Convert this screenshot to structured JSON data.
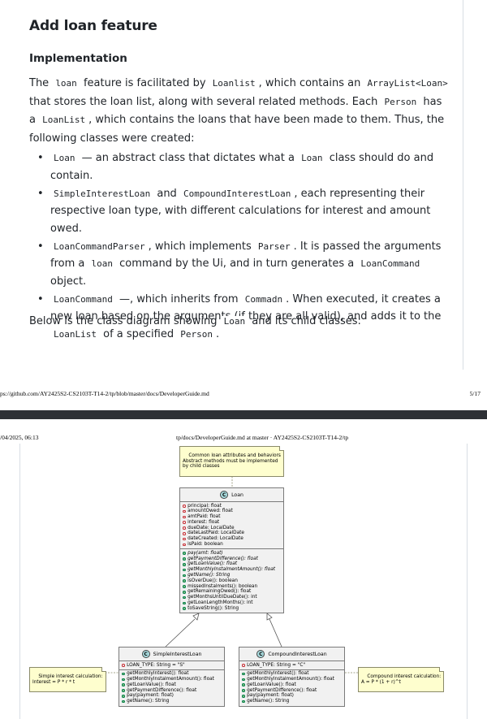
{
  "page1": {
    "heading": "Add loan feature",
    "subheading": "Implementation",
    "paragraph1": [
      {
        "t": "The "
      },
      {
        "c": "loan"
      },
      {
        "t": " feature is facilitated by "
      },
      {
        "c": "Loanlist"
      },
      {
        "t": ", which contains an "
      },
      {
        "c": "ArrayList<Loan>"
      },
      {
        "t": " that stores the loan list, along with several related methods. Each "
      },
      {
        "c": "Person"
      },
      {
        "t": " has a "
      },
      {
        "c": "LoanList"
      },
      {
        "t": ", which contains the loans that have been made to them. Thus, the following classes were created:"
      }
    ],
    "bullets": [
      [
        {
          "c": "Loan"
        },
        {
          "t": " — an abstract class that dictates what a "
        },
        {
          "c": "Loan"
        },
        {
          "t": " class should do and contain."
        }
      ],
      [
        {
          "c": "SimpleInterestLoan"
        },
        {
          "t": " and "
        },
        {
          "c": "CompoundInterestLoan"
        },
        {
          "t": ", each representing their respective loan type, with different calculations for interest and amount owed."
        }
      ],
      [
        {
          "c": "LoanCommandParser"
        },
        {
          "t": ", which implements "
        },
        {
          "c": "Parser"
        },
        {
          "t": ". It is passed the arguments from a "
        },
        {
          "c": "loan"
        },
        {
          "t": " command by the Ui, and in turn generates a "
        },
        {
          "c": "LoanCommand"
        },
        {
          "t": " object."
        }
      ],
      [
        {
          "c": "LoanCommand"
        },
        {
          "t": " —, which inherits from "
        },
        {
          "c": "Commadn"
        },
        {
          "t": ". When executed, it creates a new loan based on the arguments (if they are all valid), and adds it to the "
        },
        {
          "c": "LoanList"
        },
        {
          "t": " of a specified "
        },
        {
          "c": "Person"
        },
        {
          "t": "."
        }
      ]
    ],
    "paragraph2": [
      {
        "t": "Below is the class diagram showing "
      },
      {
        "c": "Loan"
      },
      {
        "t": " and its child classes:"
      }
    ],
    "footer_url": "ps://github.com/AY2425S2-CS2103T-T14-2/tp/blob/master/docs/DeveloperGuide.md",
    "footer_page": "5/17"
  },
  "page2": {
    "header_date": "/04/2025, 06:13",
    "header_title": "tp/docs/DeveloperGuide.md at master · AY2425S2-CS2103T-T14-2/tp"
  },
  "uml": {
    "note_top": "Common loan attributes and behaviors\nAbstract methods must be implemented\nby child classes",
    "note_left": "Simple interest calculation:\nInterest = P * r * t",
    "note_right": "Compound interest calculation:\nA = P * (1 + r)^t",
    "loan": {
      "stereotype": "C",
      "name": "Loan",
      "fields": [
        {
          "vis": "prot",
          "text": "principal: float"
        },
        {
          "vis": "prot",
          "text": "amountOwed: float"
        },
        {
          "vis": "prot",
          "text": "amtPaid: float"
        },
        {
          "vis": "prot",
          "text": "interest: float"
        },
        {
          "vis": "prot",
          "text": "dueDate: LocalDate"
        },
        {
          "vis": "prot",
          "text": "dateLastPaid: LocalDate"
        },
        {
          "vis": "prot",
          "text": "dateCreated: LocalDate"
        },
        {
          "vis": "prot",
          "text": "isPaid: boolean"
        }
      ],
      "methods": [
        {
          "vis": "pub",
          "text": "pay(amt: float)",
          "abstract": true
        },
        {
          "vis": "pub",
          "text": "getPaymentDifference(): float",
          "abstract": true
        },
        {
          "vis": "pub",
          "text": "getLoanValue(): float",
          "abstract": true
        },
        {
          "vis": "pub",
          "text": "getMonthlyInstalmentAmount(): float",
          "abstract": true
        },
        {
          "vis": "pub",
          "text": "getName(): String",
          "abstract": true
        },
        {
          "vis": "pub",
          "text": "isOverDue(): boolean"
        },
        {
          "vis": "pub",
          "text": "missedInstalments(): boolean"
        },
        {
          "vis": "pub",
          "text": "getRemainingOwed(): float"
        },
        {
          "vis": "pub",
          "text": "getMonthsUntilDueDate(): int"
        },
        {
          "vis": "pub",
          "text": "getLoanLengthMonths(): int"
        },
        {
          "vis": "pub",
          "text": "toSaveString(): String"
        }
      ]
    },
    "simple": {
      "stereotype": "C",
      "name": "SimpleInterestLoan",
      "fields": [
        {
          "vis": "prot",
          "text": "LOAN_TYPE: String = \"S\""
        }
      ],
      "methods": [
        {
          "vis": "pub",
          "text": "getMonthlyInterest(): float"
        },
        {
          "vis": "pub",
          "text": "getMonthlyInstalmentAmount(): float"
        },
        {
          "vis": "pub",
          "text": "getLoanValue(): float"
        },
        {
          "vis": "pub",
          "text": "getPaymentDifference(): float"
        },
        {
          "vis": "pub",
          "text": "pay(payment: float)"
        },
        {
          "vis": "pub",
          "text": "getName(): String"
        }
      ]
    },
    "compound": {
      "stereotype": "C",
      "name": "CompoundInterestLoan",
      "fields": [
        {
          "vis": "prot",
          "text": "LOAN_TYPE: String = \"C\""
        }
      ],
      "methods": [
        {
          "vis": "pub",
          "text": "getMonthlyInterest(): float"
        },
        {
          "vis": "pub",
          "text": "getMonthlyInstalmentAmount(): float"
        },
        {
          "vis": "pub",
          "text": "getLoanValue(): float"
        },
        {
          "vis": "pub",
          "text": "getPaymentDifference(): float"
        },
        {
          "vis": "pub",
          "text": "pay(payment: float)"
        },
        {
          "vis": "pub",
          "text": "getName(): String"
        }
      ]
    }
  }
}
